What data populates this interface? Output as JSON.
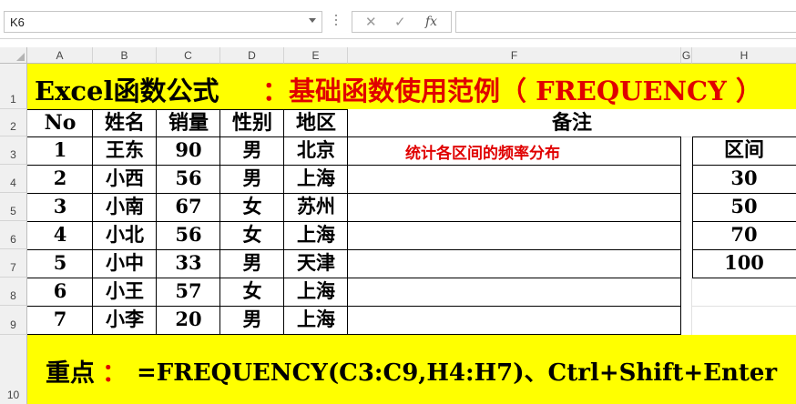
{
  "name_box": {
    "value": "K6"
  },
  "formula_bar": {
    "cancel_icon": "✕",
    "enter_icon": "✓",
    "fx_label": "fx",
    "value": ""
  },
  "columns": [
    "A",
    "B",
    "C",
    "D",
    "E",
    "F",
    "G",
    "H"
  ],
  "rows": [
    "1",
    "2",
    "3",
    "4",
    "5",
    "6",
    "7",
    "8",
    "9",
    "10"
  ],
  "title": {
    "black": "Excel函数公式",
    "red": "：基础函数使用范例（ FREQUENCY ）"
  },
  "table": {
    "headers": [
      "No",
      "姓名",
      "销量",
      "性别",
      "地区",
      "备注"
    ],
    "records": [
      {
        "no": "1",
        "name": "王东",
        "sales": "90",
        "gender": "男",
        "region": "北京"
      },
      {
        "no": "2",
        "name": "小西",
        "sales": "56",
        "gender": "男",
        "region": "上海"
      },
      {
        "no": "3",
        "name": "小南",
        "sales": "67",
        "gender": "女",
        "region": "苏州"
      },
      {
        "no": "4",
        "name": "小北",
        "sales": "56",
        "gender": "女",
        "region": "上海"
      },
      {
        "no": "5",
        "name": "小中",
        "sales": "33",
        "gender": "男",
        "region": "天津"
      },
      {
        "no": "6",
        "name": "小王",
        "sales": "57",
        "gender": "女",
        "region": "上海"
      },
      {
        "no": "7",
        "name": "小李",
        "sales": "20",
        "gender": "男",
        "region": "上海"
      }
    ],
    "remark": "统计各区间的频率分布"
  },
  "intervals": {
    "header": "区间",
    "values": [
      "30",
      "50",
      "70",
      "100"
    ]
  },
  "note": {
    "label": "重点",
    "colon": "：",
    "formula": "=FREQUENCY(C3:C9,H4:H7)、Ctrl+Shift+Enter"
  },
  "colors": {
    "highlight": "#ffff00",
    "accent": "#e00000"
  }
}
